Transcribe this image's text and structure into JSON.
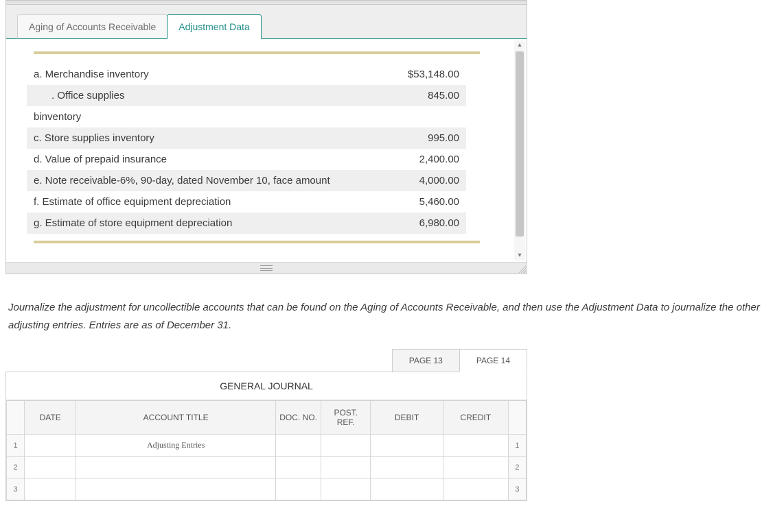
{
  "topPanel": {
    "tabs": [
      {
        "label": "Aging of Accounts Receivable",
        "active": false
      },
      {
        "label": "Adjustment Data",
        "active": true
      }
    ],
    "rows": [
      {
        "label": "a. Merchandise inventory",
        "value": "$53,148.00",
        "zebra": false,
        "indent": false
      },
      {
        "label": ". Office supplies",
        "value": "845.00",
        "zebra": true,
        "indent": true
      },
      {
        "label": "binventory",
        "value": "",
        "zebra": false,
        "indent": false
      },
      {
        "label": "c. Store supplies inventory",
        "value": "995.00",
        "zebra": true,
        "indent": false
      },
      {
        "label": "d. Value of prepaid insurance",
        "value": "2,400.00",
        "zebra": false,
        "indent": false
      },
      {
        "label": "e. Note receivable-6%, 90-day, dated November 10, face amount",
        "value": "4,000.00",
        "zebra": true,
        "indent": false
      },
      {
        "label": "f. Estimate of office equipment depreciation",
        "value": "5,460.00",
        "zebra": false,
        "indent": false
      },
      {
        "label": "g. Estimate of store equipment depreciation",
        "value": "6,980.00",
        "zebra": true,
        "indent": false
      }
    ]
  },
  "instructions": "Journalize the adjustment for uncollectible accounts that can be found on the Aging of Accounts Receivable, and then use the Adjustment Data to journalize the other adjusting entries. Entries are as of December 31.",
  "journal": {
    "pageTabs": [
      {
        "label": "PAGE 13",
        "active": false
      },
      {
        "label": "PAGE 14",
        "active": true
      }
    ],
    "title": "GENERAL JOURNAL",
    "headers": {
      "date": "DATE",
      "accountTitle": "ACCOUNT TITLE",
      "docNo": "DOC. NO.",
      "postRef": "POST. REF.",
      "debit": "DEBIT",
      "credit": "CREDIT"
    },
    "rows": [
      {
        "n": "1",
        "title": "Adjusting Entries"
      },
      {
        "n": "2",
        "title": ""
      },
      {
        "n": "3",
        "title": ""
      }
    ]
  }
}
